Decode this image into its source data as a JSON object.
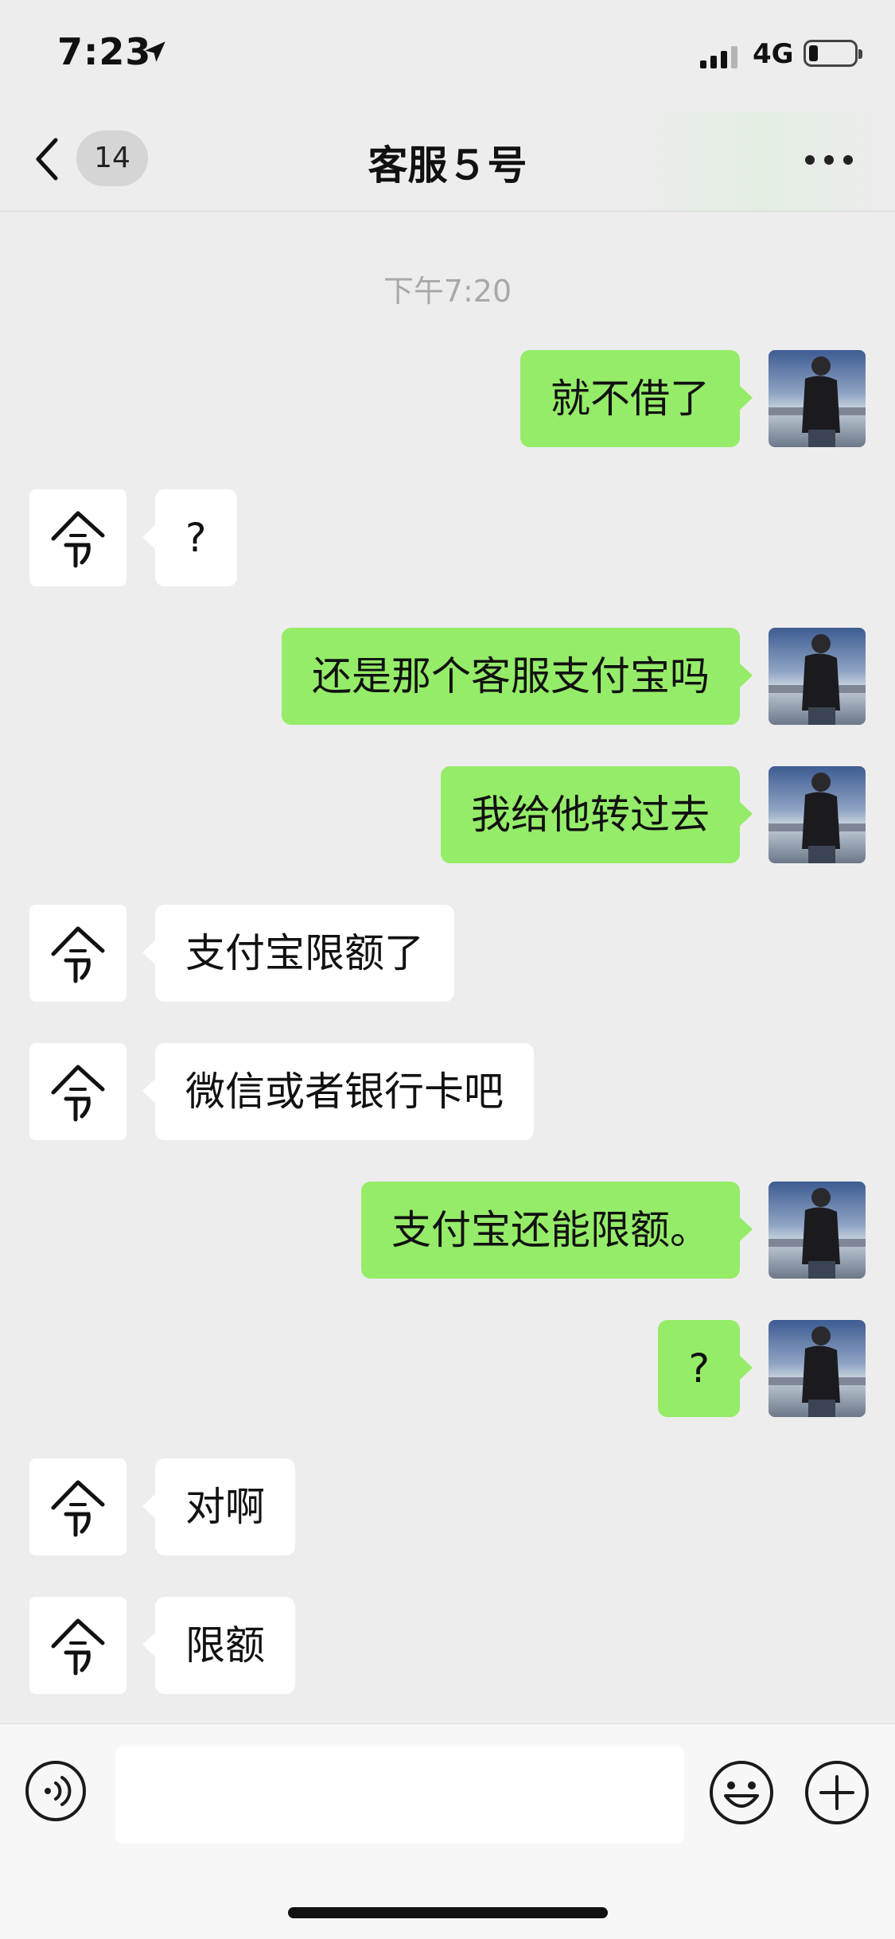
{
  "status_bar": {
    "time": "7:23",
    "network": "4G",
    "battery_level": 0.2
  },
  "nav": {
    "back_icon": "chevron-left-icon",
    "unread_count": "14",
    "title": "客服５号",
    "more_icon": "more-dots-icon"
  },
  "timestamp": "下午7:20",
  "messages": [
    {
      "from": "me",
      "text": "就不借了"
    },
    {
      "from": "other",
      "text": "?"
    },
    {
      "from": "me",
      "text": "还是那个客服支付宝吗"
    },
    {
      "from": "me",
      "text": "我给他转过去"
    },
    {
      "from": "other",
      "text": "支付宝限额了"
    },
    {
      "from": "other",
      "text": "微信或者银行卡吧"
    },
    {
      "from": "me",
      "text": "支付宝还能限额。"
    },
    {
      "from": "me",
      "text": "?"
    },
    {
      "from": "other",
      "text": "对啊"
    },
    {
      "from": "other",
      "text": "限额"
    }
  ],
  "input_bar": {
    "voice_icon": "voice-icon",
    "emoji_icon": "emoji-icon",
    "plus_icon": "plus-icon",
    "input_value": ""
  },
  "colors": {
    "background": "#ededed",
    "my_bubble": "#95ec69",
    "other_bubble": "#ffffff",
    "timestamp": "#a8a8a8"
  }
}
